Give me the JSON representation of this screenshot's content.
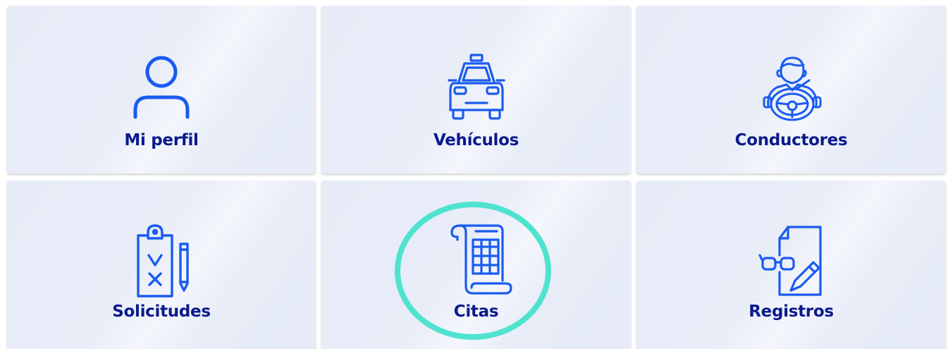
{
  "tiles": [
    {
      "label": "Mi perfil",
      "icon": "user-icon"
    },
    {
      "label": "Vehículos",
      "icon": "taxi-icon"
    },
    {
      "label": "Conductores",
      "icon": "driver-icon"
    },
    {
      "label": "Solicitudes",
      "icon": "checklist-icon"
    },
    {
      "label": "Citas",
      "icon": "schedule-scroll-icon"
    },
    {
      "label": "Registros",
      "icon": "document-review-icon"
    }
  ],
  "colors": {
    "icon": "#1a5bf0",
    "label": "#0a1a8c",
    "tile_bg": "#e6ebf7",
    "highlight": "#4fe3cf"
  }
}
